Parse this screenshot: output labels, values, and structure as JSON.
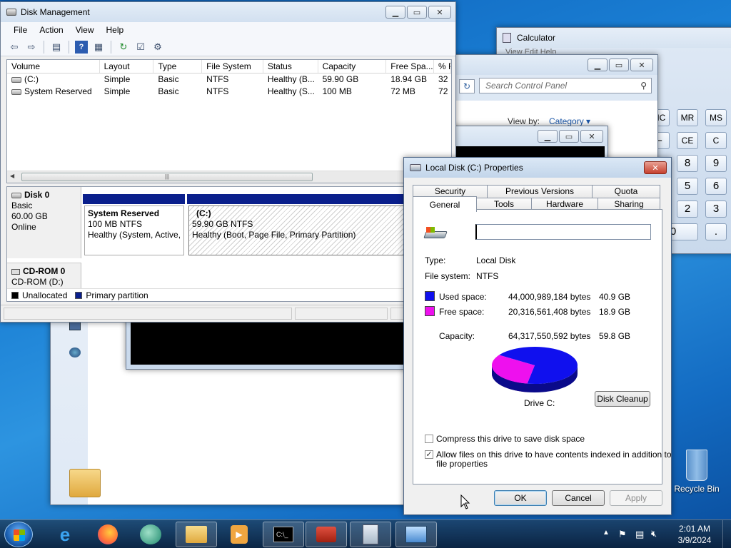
{
  "calculator": {
    "title": "Calculator",
    "menu_partial": "View  Edit  Help",
    "buttons": {
      "mc": "MC",
      "mr": "MR",
      "ms": "MS",
      "minus": "–",
      "ce": "CE",
      "c": "C",
      "n8": "8",
      "n9": "9",
      "n5": "5",
      "n6": "6",
      "n2": "2",
      "n3": "3",
      "n0": "0",
      "dot": "."
    }
  },
  "control_panel": {
    "search_placeholder": "Search Control Panel",
    "view_by_label": "View by:",
    "view_by_value": "Category"
  },
  "disk_management": {
    "title": "Disk Management",
    "menu": [
      "File",
      "Action",
      "View",
      "Help"
    ],
    "columns": [
      "Volume",
      "Layout",
      "Type",
      "File System",
      "Status",
      "Capacity",
      "Free Spa...",
      "% F"
    ],
    "rows": [
      [
        "(C:)",
        "Simple",
        "Basic",
        "NTFS",
        "Healthy (B...",
        "59.90 GB",
        "18.94 GB",
        "32"
      ],
      [
        "System Reserved",
        "Simple",
        "Basic",
        "NTFS",
        "Healthy (S...",
        "100 MB",
        "72 MB",
        "72"
      ]
    ],
    "disk0": {
      "name": "Disk 0",
      "type": "Basic",
      "size": "60.00 GB",
      "status": "Online"
    },
    "part_reserved": {
      "name": "System Reserved",
      "size": "100 MB NTFS",
      "status": "Healthy (System, Active,"
    },
    "part_c": {
      "name": "(C:)",
      "size": "59.90 GB NTFS",
      "status": "Healthy (Boot, Page File, Primary Partition)"
    },
    "cdrom": {
      "name": "CD-ROM 0",
      "drive": "CD-ROM (D:)"
    },
    "legend": {
      "unallocated": "Unallocated",
      "primary": "Primary partition"
    },
    "colors": {
      "primary": "#0a1f8c",
      "unallocated": "#000000"
    }
  },
  "properties": {
    "title": "Local Disk (C:) Properties",
    "tabs_top": [
      "Security",
      "Previous Versions",
      "Quota"
    ],
    "tabs_bottom": [
      "General",
      "Tools",
      "Hardware",
      "Sharing"
    ],
    "active_tab": "General",
    "label_value": "",
    "type_label": "Type:",
    "type_value": "Local Disk",
    "fs_label": "File system:",
    "fs_value": "NTFS",
    "used_label": "Used space:",
    "used_bytes": "44,000,989,184 bytes",
    "used_gb": "40.9 GB",
    "free_label": "Free space:",
    "free_bytes": "20,316,561,408 bytes",
    "free_gb": "18.9 GB",
    "cap_label": "Capacity:",
    "cap_bytes": "64,317,550,592 bytes",
    "cap_gb": "59.8 GB",
    "drive_label": "Drive C:",
    "disk_cleanup": "Disk Cleanup",
    "compress_label": "Compress this drive to save disk space",
    "compress_checked": false,
    "index_label_1": "Allow files on this drive to have contents indexed in addition to",
    "index_label_2": "file properties",
    "index_checked": true,
    "ok": "OK",
    "cancel": "Cancel",
    "apply": "Apply",
    "used_fraction": 0.684,
    "colors": {
      "used": "#1010ee",
      "free": "#ee10ee"
    }
  },
  "desktop": {
    "recycle_bin": "Recycle Bin",
    "clock_time": "2:01 AM",
    "clock_date": "3/9/2024"
  }
}
